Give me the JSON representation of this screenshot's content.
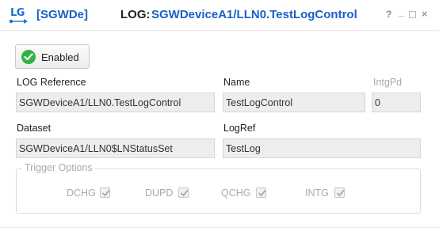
{
  "title": {
    "logo_text": "LG",
    "ied": "[SGWDe]",
    "prefix": "LOG:",
    "path": "SGWDeviceA1/LLN0.TestLogControl"
  },
  "window_controls": {
    "help": "?",
    "minimize": "_",
    "close": "×"
  },
  "enabled_button": {
    "label": "Enabled",
    "icon": "check-circle-icon",
    "color": "#2fb344"
  },
  "fields": {
    "log_reference": {
      "label": "LOG Reference",
      "value": "SGWDeviceA1/LLN0.TestLogControl"
    },
    "name": {
      "label": "Name",
      "value": "TestLogControl"
    },
    "intg_pd": {
      "label": "IntgPd",
      "value": "0",
      "disabled": true
    },
    "dataset": {
      "label": "Dataset",
      "value": "SGWDeviceA1/LLN0$LNStatusSet"
    },
    "log_ref": {
      "label": "LogRef",
      "value": "TestLog"
    }
  },
  "trigger_options": {
    "title": "Trigger Options",
    "items": [
      {
        "label": "DCHG",
        "checked": true
      },
      {
        "label": "DUPD",
        "checked": true
      },
      {
        "label": "QCHG",
        "checked": true
      },
      {
        "label": "INTG",
        "checked": true
      }
    ]
  },
  "colors": {
    "accent_blue": "#1a5fc4",
    "disabled_text": "#aaaaaa",
    "field_bg": "#ededed"
  }
}
